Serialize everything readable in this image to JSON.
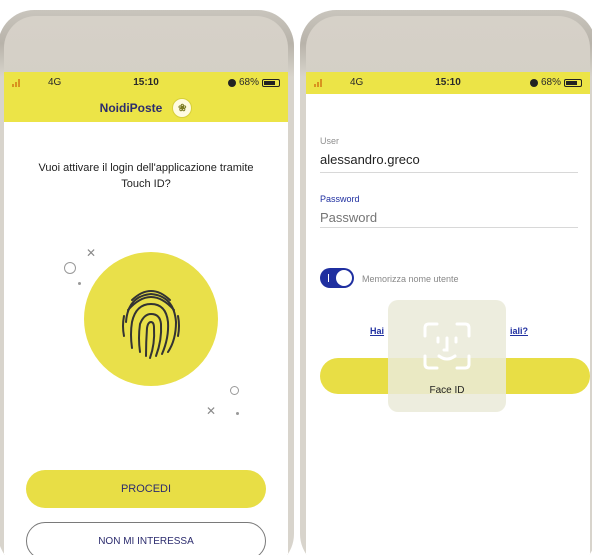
{
  "left_phone": {
    "status": {
      "network": "4G",
      "time": "15:10",
      "battery": "68%"
    },
    "app_title": "NoidiPoste",
    "question": "Vuoi attivare il login dell'applicazione tramite Touch ID?",
    "primary_button": "PROCEDI",
    "secondary_button": "NON MI INTERESSA"
  },
  "right_phone": {
    "status": {
      "network": "4G",
      "time": "15:10",
      "battery": "68%"
    },
    "user_label": "User",
    "user_value": "alessandro.greco",
    "password_label": "Password",
    "password_placeholder": "Password",
    "remember_label": "Memorizza nome utente",
    "remember_on": true,
    "forgot_link_left": "Hai",
    "forgot_link_right": "iali?",
    "face_id_label": "Face ID"
  },
  "colors": {
    "brand_yellow": "#e8de45",
    "brand_blue": "#1f2fa0"
  },
  "icons": [
    "signal-icon",
    "battery-icon",
    "do-not-disturb-icon",
    "fingerprint-icon",
    "face-id-icon"
  ]
}
